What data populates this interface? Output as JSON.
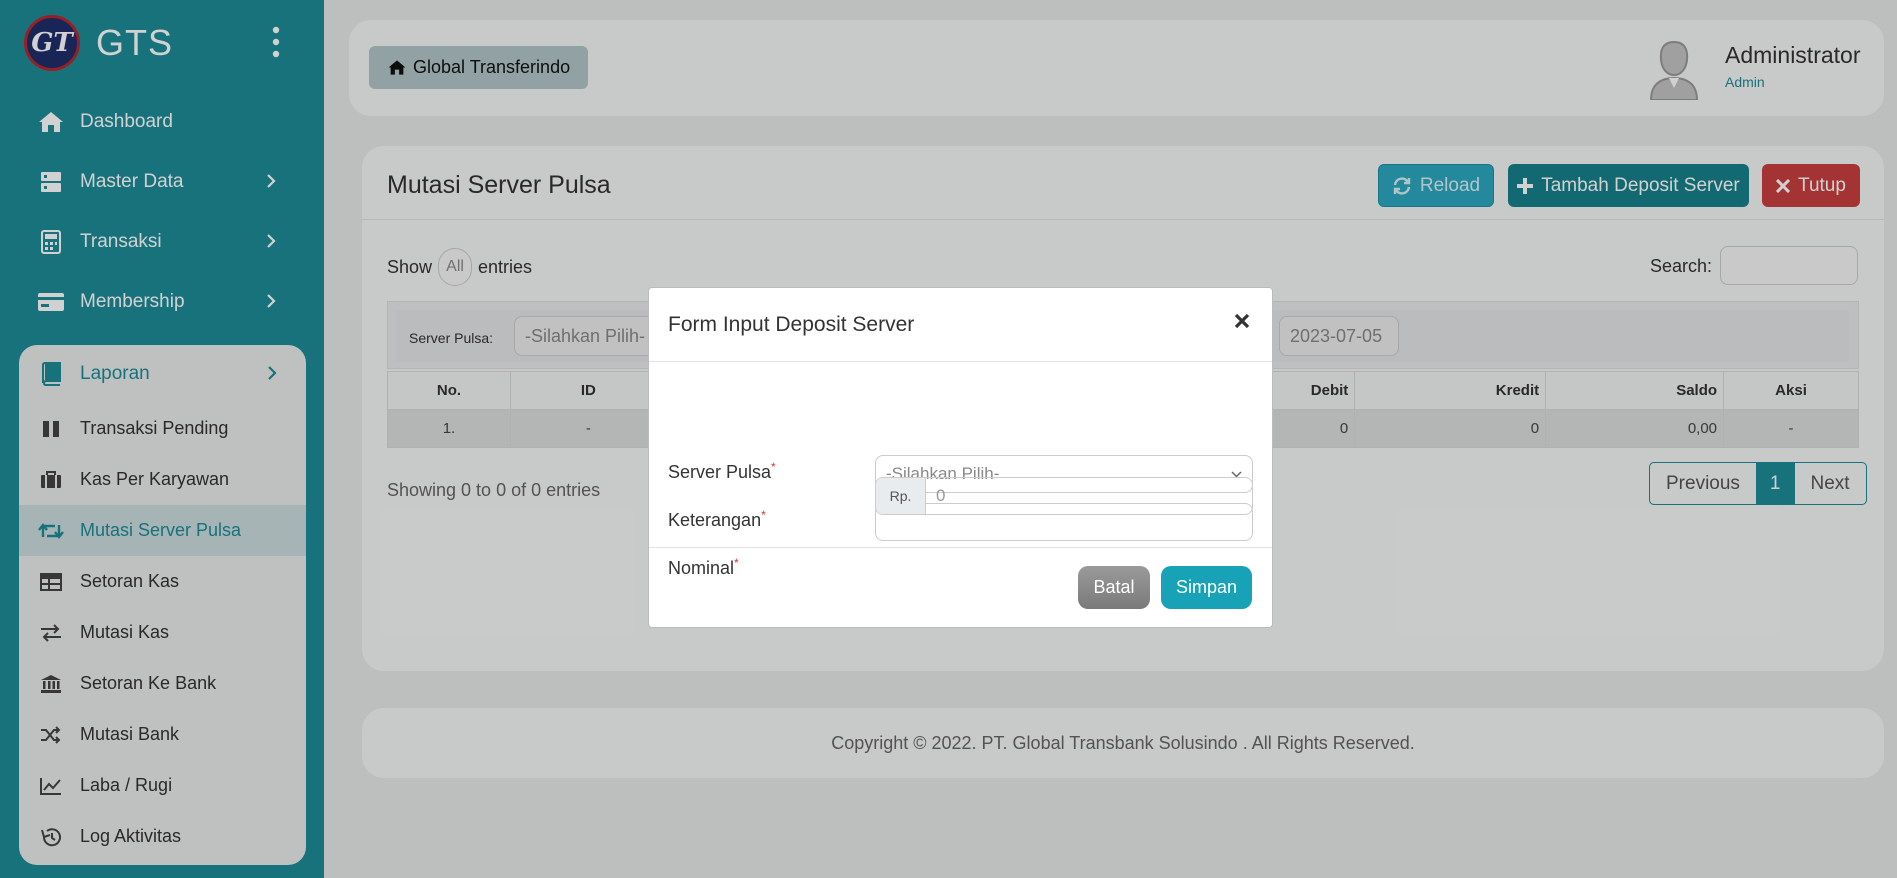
{
  "app": {
    "name": "GTS",
    "logo_text": "GT"
  },
  "sidebar": {
    "items": [
      {
        "label": "Dashboard",
        "icon": "home-icon"
      },
      {
        "label": "Master Data",
        "icon": "server-icon"
      },
      {
        "label": "Transaksi",
        "icon": "calculator-icon"
      },
      {
        "label": "Membership",
        "icon": "card-icon"
      }
    ],
    "laporan": {
      "label": "Laporan",
      "icon": "book-icon",
      "items": [
        {
          "label": "Transaksi Pending",
          "icon": "pause-icon"
        },
        {
          "label": "Kas Per Karyawan",
          "icon": "suitcase-icon"
        },
        {
          "label": "Mutasi Server Pulsa",
          "icon": "retweet-icon",
          "active": true
        },
        {
          "label": "Setoran Kas",
          "icon": "table-icon"
        },
        {
          "label": "Mutasi Kas",
          "icon": "exchange-icon"
        },
        {
          "label": "Setoran Ke Bank",
          "icon": "bank-icon"
        },
        {
          "label": "Mutasi Bank",
          "icon": "shuffle-icon"
        },
        {
          "label": "Laba / Rugi",
          "icon": "line-chart-icon"
        },
        {
          "label": "Log Aktivitas",
          "icon": "history-icon"
        }
      ]
    }
  },
  "header": {
    "breadcrumb": "Global Transferindo",
    "user_name": "Administrator",
    "user_role": "Admin"
  },
  "main": {
    "title": "Mutasi Server Pulsa",
    "buttons": {
      "reload": "Reload",
      "tambah": "Tambah Deposit Server",
      "tutup": "Tutup"
    },
    "show_label": "Show",
    "length_value": "All",
    "entries_label": "entries",
    "search_label": "Search:",
    "filter": {
      "label": "Server Pulsa:",
      "select_placeholder": "-Silahkan Pilih-",
      "date": "2023-07-05"
    },
    "table": {
      "headers": [
        "No.",
        "ID",
        "Debit",
        "Kredit",
        "Saldo",
        "Aksi"
      ],
      "rows": [
        [
          "1.",
          "-",
          "0",
          "0",
          "0,00",
          "-"
        ]
      ]
    },
    "showing": "Showing 0 to 0 of 0 entries",
    "pager": {
      "previous": "Previous",
      "current": "1",
      "next": "Next"
    }
  },
  "footer": {
    "text": "Copyright © 2022. PT. Global Transbank Solusindo . All Rights Reserved."
  },
  "modal": {
    "title": "Form Input Deposit Server",
    "fields": {
      "server_label": "Server Pulsa",
      "server_placeholder": "-Silahkan Pilih-",
      "keterangan_label": "Keterangan",
      "keterangan_value": "",
      "nominal_label": "Nominal",
      "nominal_addon": "Rp.",
      "nominal_placeholder": "0",
      "required_mark": "*"
    },
    "buttons": {
      "batal": "Batal",
      "simpan": "Simpan"
    }
  },
  "colors": {
    "primary": "#1e8c96",
    "info": "#17a2b8",
    "danger": "#c9403f",
    "secondary": "#888888"
  }
}
